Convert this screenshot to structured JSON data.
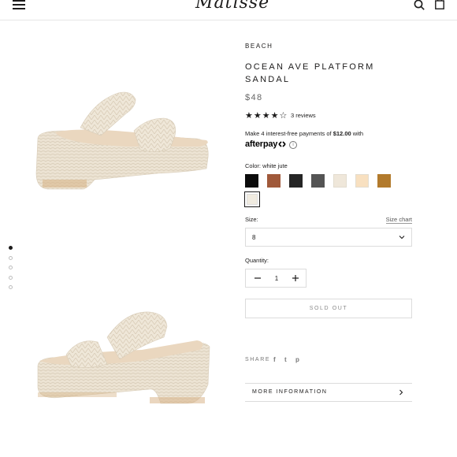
{
  "header": {
    "logo": "Matisse",
    "menu_icon": "hamburger-menu-icon",
    "search_icon": "search-icon",
    "cart_icon": "shopping-bag-icon"
  },
  "gallery": {
    "dots": 5,
    "active_dot": 0,
    "image_color": "#ece3d3"
  },
  "product": {
    "vendor": "BEACH",
    "title": "OCEAN AVE PLATFORM SANDAL",
    "price": "$48",
    "rating": 4,
    "max_rating": 5,
    "reviews_label": "3 reviews",
    "afterpay": {
      "text_before": "Make 4 interest-free payments of ",
      "amount": "$12.00",
      "text_after": " with",
      "logo": "afterpay",
      "info_icon": "i"
    },
    "color_label": "Color: white jute",
    "swatches": [
      {
        "name": "black",
        "hex": "#0b0b0b"
      },
      {
        "name": "brown",
        "hex": "#a0593a"
      },
      {
        "name": "dark-charcoal",
        "hex": "#252525"
      },
      {
        "name": "grey",
        "hex": "#545454"
      },
      {
        "name": "cream",
        "hex": "#efe7da"
      },
      {
        "name": "light-tan",
        "hex": "#f8e0c0"
      },
      {
        "name": "tan",
        "hex": "#b27a2c"
      },
      {
        "name": "white-jute",
        "hex": "#f0ebe0",
        "selected": true
      }
    ],
    "size_label": "Size:",
    "size_chart_label": "Size chart",
    "size_value": "8",
    "quantity_label": "Quantity:",
    "quantity_value": "1",
    "soldout_label": "SOLD OUT",
    "share_label": "SHARE",
    "share_icons": [
      "f",
      "t",
      "p"
    ],
    "more_info_label": "MORE INFORMATION"
  }
}
